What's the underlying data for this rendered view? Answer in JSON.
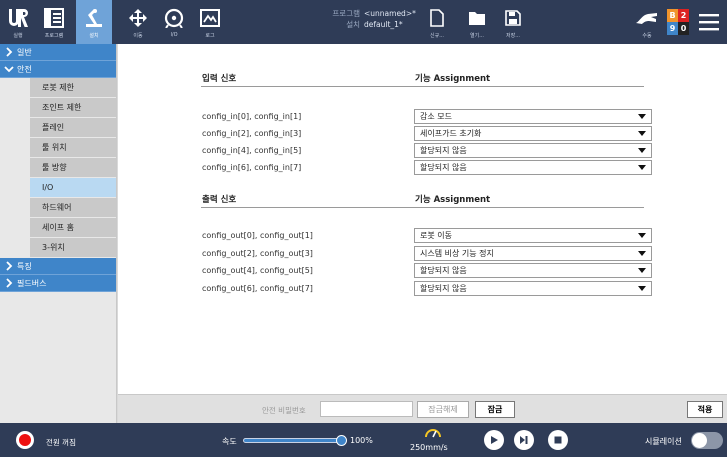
{
  "topbar": {
    "buttons": [
      {
        "label": "실행",
        "icon": "ur-logo-icon"
      },
      {
        "label": "프로그램",
        "icon": "program-icon"
      },
      {
        "label": "설치",
        "icon": "installation-icon",
        "active": true
      },
      {
        "label": "이동",
        "icon": "move-icon"
      },
      {
        "label": "I/O",
        "icon": "io-icon"
      },
      {
        "label": "로그",
        "icon": "log-icon"
      }
    ],
    "program_key": "프로그램",
    "program_value": "<unnamed>*",
    "install_key": "설치",
    "install_value": "default_1*",
    "file_buttons": [
      {
        "label": "신규...",
        "icon": "new-file-icon"
      },
      {
        "label": "열기...",
        "icon": "open-folder-icon"
      },
      {
        "label": "저장...",
        "icon": "save-icon"
      }
    ],
    "manual_label": "수동",
    "status": {
      "b": "B",
      "n2": "2",
      "n9": "9",
      "n0": "0"
    },
    "accent": "#6fa3d8",
    "bg": "#2f3c57"
  },
  "sidebar": {
    "groups": [
      {
        "label": "일반",
        "expanded": false
      },
      {
        "label": "안전",
        "expanded": true
      },
      {
        "label": "특징",
        "expanded": false
      },
      {
        "label": "필드버스",
        "expanded": false
      }
    ],
    "safety_items": [
      "로봇 제한",
      "조인트 제한",
      "플레인",
      "툴 위치",
      "툴 방향",
      "I/O",
      "하드웨어",
      "세이프 홈",
      "3-위치"
    ],
    "selected": "I/O"
  },
  "main": {
    "input": {
      "header": "입력 신호",
      "func_header": "기능 Assignment",
      "rows": [
        {
          "label": "config_in[0], config_in[1]",
          "value": "감소 모드"
        },
        {
          "label": "config_in[2], config_in[3]",
          "value": "세이프가드 초기화"
        },
        {
          "label": "config_in[4], config_in[5]",
          "value": "할당되지 않음"
        },
        {
          "label": "config_in[6], config_in[7]",
          "value": "할당되지 않음"
        }
      ]
    },
    "output": {
      "header": "출력 신호",
      "func_header": "기능 Assignment",
      "rows": [
        {
          "label": "config_out[0], config_out[1]",
          "value": "로봇 이동"
        },
        {
          "label": "config_out[2], config_out[3]",
          "value": "시스템 비상 기능 정지"
        },
        {
          "label": "config_out[4], config_out[5]",
          "value": "할당되지 않음"
        },
        {
          "label": "config_out[6], config_out[7]",
          "value": "할당되지 않음"
        }
      ]
    }
  },
  "actionbar": {
    "password_label": "안전 비밀번호",
    "password_value": "",
    "unlock_label": "잠금해제",
    "lock_label": "잠금",
    "apply_label": "적용"
  },
  "footer": {
    "power_label": "전원 꺼짐",
    "speed_label": "속도",
    "speed_value": "100%",
    "speed_fraction": 1.0,
    "tcp_speed": "250mm/s",
    "sim_label": "시뮬레이션",
    "sim_on": false
  }
}
